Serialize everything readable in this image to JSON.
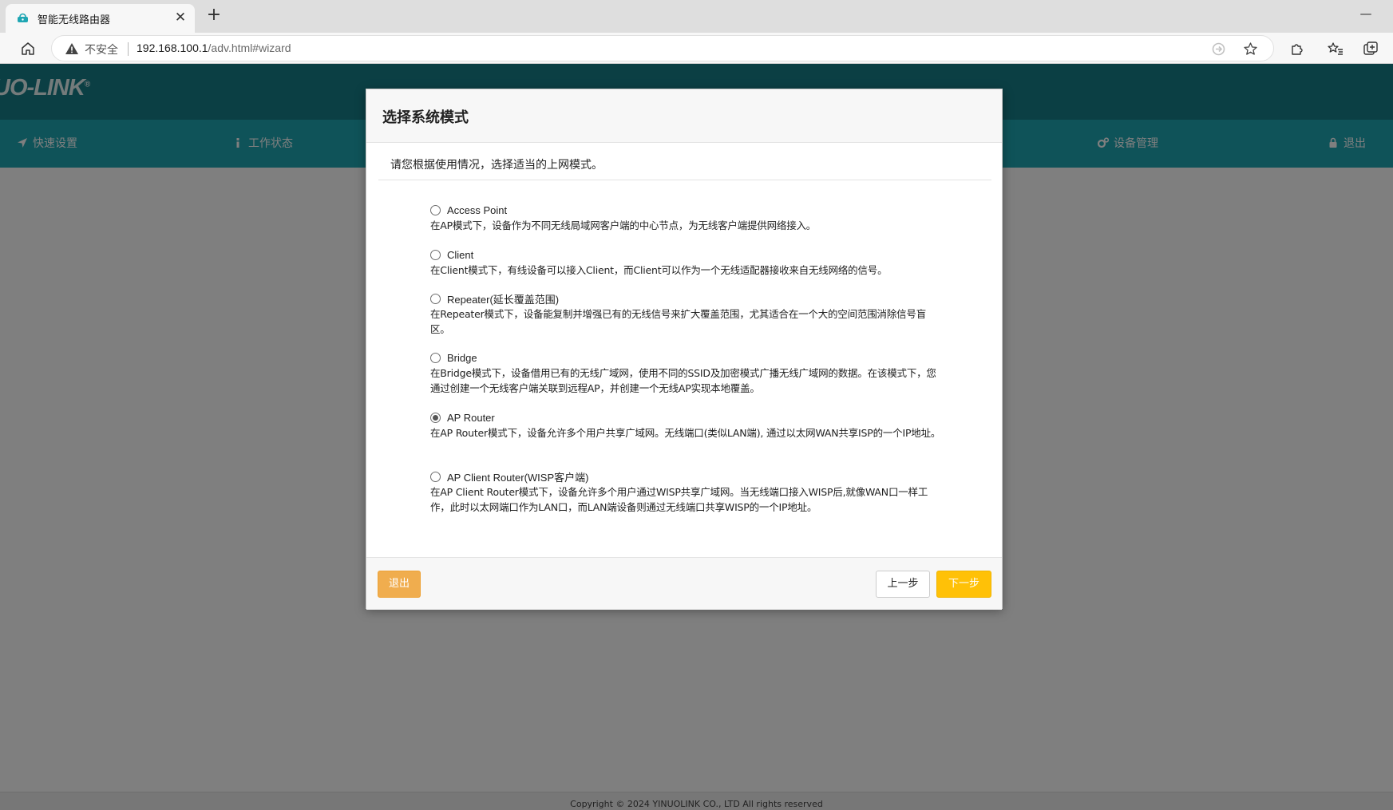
{
  "browser": {
    "tab_title": "智能无线路由器",
    "tab_close": "✕",
    "new_tab": "+",
    "minimize": "—",
    "insecure_label": "不安全",
    "url_host": "192.168.100.1",
    "url_path": "/adv.html#wizard"
  },
  "router": {
    "logo": "UO-LINK",
    "logo_mark": "®",
    "nav": {
      "quick_setup": "快速设置",
      "status": "工作状态",
      "device_mgmt": "设备管理",
      "logout": "退出"
    },
    "footer": "Copyright © 2024 YINUOLINK CO., LTD All rights reserved"
  },
  "modal": {
    "title": "选择系统模式",
    "intro": "请您根据使用情况，选择适当的上网模式。",
    "selected_mode": "AP Router",
    "options": [
      {
        "label": "Access Point",
        "desc": "在AP模式下，设备作为不同无线局域网客户端的中心节点，为无线客户端提供网络接入。"
      },
      {
        "label": "Client",
        "desc": "在Client模式下，有线设备可以接入Client，而Client可以作为一个无线适配器接收来自无线网络的信号。"
      },
      {
        "label": "Repeater(延长覆盖范围)",
        "desc": "在Repeater模式下，设备能复制并增强已有的无线信号来扩大覆盖范围，尤其适合在一个大的空间范围消除信号盲区。"
      },
      {
        "label": "Bridge",
        "desc": "在Bridge模式下，设备借用已有的无线广域网，使用不同的SSID及加密模式广播无线广域网的数据。在该模式下，您通过创建一个无线客户端关联到远程AP，并创建一个无线AP实现本地覆盖。"
      },
      {
        "label": "AP Router",
        "desc": "在AP Router模式下，设备允许多个用户共享广域网。无线端口(类似LAN端), 通过以太网WAN共享ISP的一个IP地址。"
      },
      {
        "label": "AP Client Router(WISP客户端)",
        "desc": "在AP Client Router模式下，设备允许多个用户通过WISP共享广域网。当无线端口接入WISP后,就像WAN口一样工作，此时以太网端口作为LAN口，而LAN端设备则通过无线端口共享WISP的一个IP地址。"
      }
    ],
    "buttons": {
      "exit": "退出",
      "prev": "上一步",
      "next": "下一步"
    }
  }
}
